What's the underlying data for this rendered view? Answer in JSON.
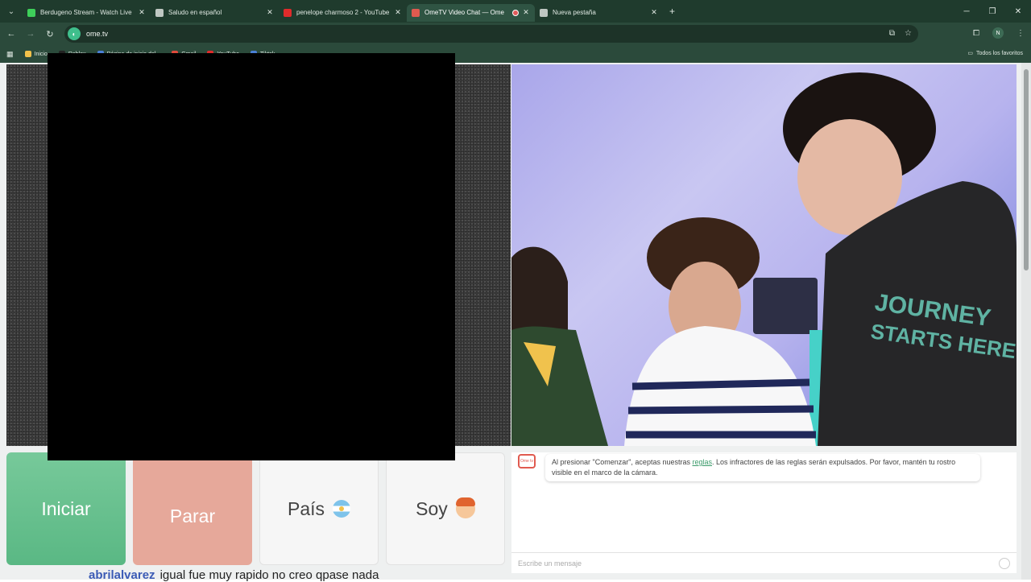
{
  "tabs": [
    {
      "title": "Berdugeno Stream - Watch Live",
      "favicon_color": "#3ecf5a",
      "active": false
    },
    {
      "title": "Saludo en español",
      "favicon_color": "#bfc7c2",
      "active": false
    },
    {
      "title": "penelope charmoso 2 - YouTube",
      "favicon_color": "#e02b2b",
      "active": false
    },
    {
      "title": "OmeTV Video Chat — Ome",
      "favicon_color": "#e05a4f",
      "active": true
    },
    {
      "title": "Nueva pestaña",
      "favicon_color": "#bfc7c2",
      "active": false
    }
  ],
  "address_bar": {
    "url": "ome.tv",
    "site_icon": "ometv-icon"
  },
  "bookmarks": [
    {
      "label": "Inicio",
      "color": "#f2c14a"
    },
    {
      "label": "Roblox",
      "color": "#222222"
    },
    {
      "label": "Página de inicio del...",
      "color": "#4a7fd6"
    },
    {
      "label": "Gmail",
      "color": "#e04a3c"
    },
    {
      "label": "YouTube",
      "color": "#e02b2b"
    },
    {
      "label": "Tiktok",
      "color": "#4a7fd6"
    }
  ],
  "bookmarks_all": "Todos los favoritos",
  "profile_initial": "N",
  "buttons": {
    "start": "Iniciar",
    "stop": "Parar",
    "country": "País",
    "gender": "Soy"
  },
  "chat": {
    "logo_text": "Ome tv",
    "message_before": "Al presionar \"Comenzar\", aceptas nuestras ",
    "message_link": "reglas",
    "message_after": ". Los infractores de las reglas serán expulsados. Por favor, mantén tu rostro visible en el marco de la cámara.",
    "input_placeholder": "Escribe un mensaje"
  },
  "caption": {
    "user": "abrilalvarez",
    "text": "igual fue muy rapido no creo qpase nada"
  },
  "colors": {
    "start": "#5ab884",
    "stop": "#e6a89a",
    "chrome": "#1f3b2d"
  }
}
